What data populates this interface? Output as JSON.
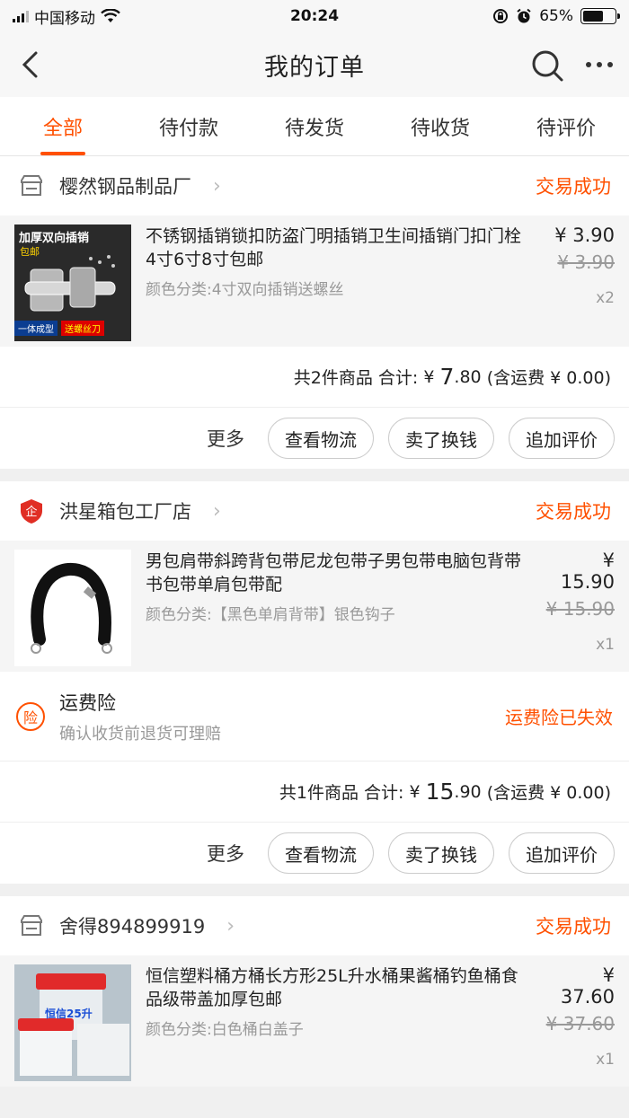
{
  "status_bar": {
    "carrier": "中国移动",
    "time": "20:24",
    "battery": "65%"
  },
  "nav": {
    "title": "我的订单"
  },
  "tabs": [
    {
      "label": "全部"
    },
    {
      "label": "待付款"
    },
    {
      "label": "待发货"
    },
    {
      "label": "待收货"
    },
    {
      "label": "待评价"
    }
  ],
  "orders": [
    {
      "shop_name": "樱然钢品制品厂",
      "status": "交易成功",
      "item": {
        "title": "不锈钢插销锁扣防盗门明插销卫生间插销门扣门栓 4寸6寸8寸包邮",
        "spec": "颜色分类:4寸双向插销送螺丝",
        "price": "¥ 3.90",
        "orig_price": "¥ 3.90",
        "qty": "x2",
        "img_text_top": "加厚双向插销",
        "img_text_tag": "包邮",
        "img_text_b1": "一体成型",
        "img_text_b2": "送螺丝刀"
      },
      "total": {
        "count": "共2件商品",
        "label": "合计:",
        "currency": "¥",
        "int": "7",
        "dec": ".80",
        "shipping": "(含运费 ¥ 0.00)"
      },
      "buttons": {
        "more": "更多",
        "logistics": "查看物流",
        "resell": "卖了换钱",
        "review": "追加评价"
      }
    },
    {
      "shop_name": "洪星箱包工厂店",
      "shop_badge": "企",
      "status": "交易成功",
      "item": {
        "title": "男包肩带斜跨背包带尼龙包带子男包带电脑包背带书包带单肩包带配",
        "spec": "颜色分类:【黑色单肩背带】银色钩子",
        "price": "¥ 15.90",
        "orig_price": "¥ 15.90",
        "qty": "x1"
      },
      "insurance": {
        "icon_text": "险",
        "title": "运费险",
        "subtitle": "确认收货前退货可理赔",
        "status": "运费险已失效"
      },
      "total": {
        "count": "共1件商品",
        "label": "合计:",
        "currency": "¥",
        "int": "15",
        "dec": ".90",
        "shipping": "(含运费 ¥ 0.00)"
      },
      "buttons": {
        "more": "更多",
        "logistics": "查看物流",
        "resell": "卖了换钱",
        "review": "追加评价"
      }
    },
    {
      "shop_name": "舍得894899919",
      "status": "交易成功",
      "item": {
        "title": "恒信塑料桶方桶长方形25L升水桶果酱桶钓鱼桶食品级带盖加厚包邮",
        "spec": "颜色分类:白色桶白盖子",
        "price": "¥ 37.60",
        "orig_price": "¥ 37.60",
        "qty": "x1",
        "img_text": "恒信25升"
      }
    }
  ]
}
